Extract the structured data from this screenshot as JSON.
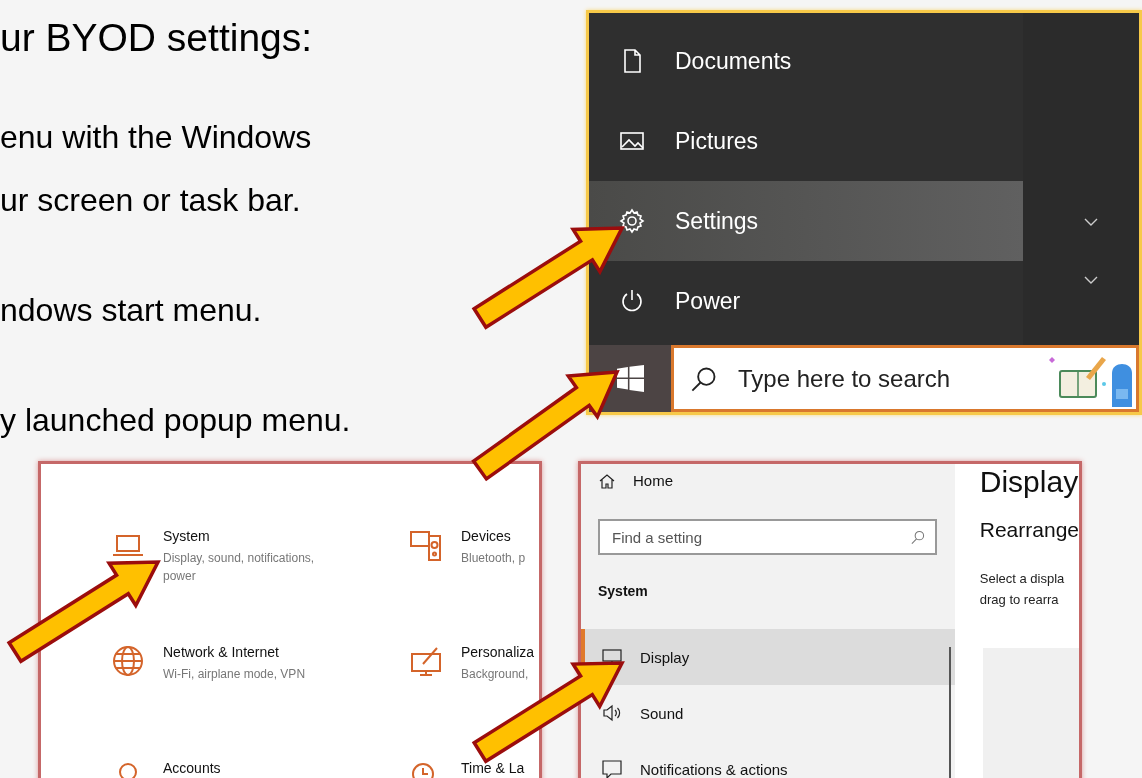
{
  "slide": {
    "title": "ur BYOD settings:",
    "paragraphs": [
      [
        "enu with the Windows",
        "ur screen or task bar."
      ],
      [
        "ndows start menu."
      ],
      [
        "y launched popup menu."
      ]
    ]
  },
  "start_menu": {
    "items": [
      {
        "label": "Documents",
        "selected": false
      },
      {
        "label": "Pictures",
        "selected": false
      },
      {
        "label": "Settings",
        "selected": true
      },
      {
        "label": "Power",
        "selected": false
      }
    ],
    "search": {
      "placeholder": "Type here to search"
    }
  },
  "settings_home": {
    "tiles": [
      {
        "title": "System",
        "subtitle": "Display, sound, notifications, power"
      },
      {
        "title": "Devices",
        "subtitle": "Bluetooth, p"
      },
      {
        "title": "Network & Internet",
        "subtitle": "Wi-Fi, airplane mode, VPN"
      },
      {
        "title": "Personaliza",
        "subtitle": "Background,"
      },
      {
        "title": "Accounts"
      },
      {
        "title": "Time & La"
      }
    ]
  },
  "system_settings": {
    "home": "Home",
    "search": {
      "placeholder": "Find a setting"
    },
    "section": "System",
    "nav": [
      {
        "label": "Display",
        "selected": true
      },
      {
        "label": "Sound",
        "selected": false
      },
      {
        "label": "Notifications & actions",
        "selected": false
      }
    ],
    "page_title": "Display",
    "heading": "Rearrange",
    "description_lines": [
      "Select a displa",
      "drag to rearra"
    ]
  }
}
